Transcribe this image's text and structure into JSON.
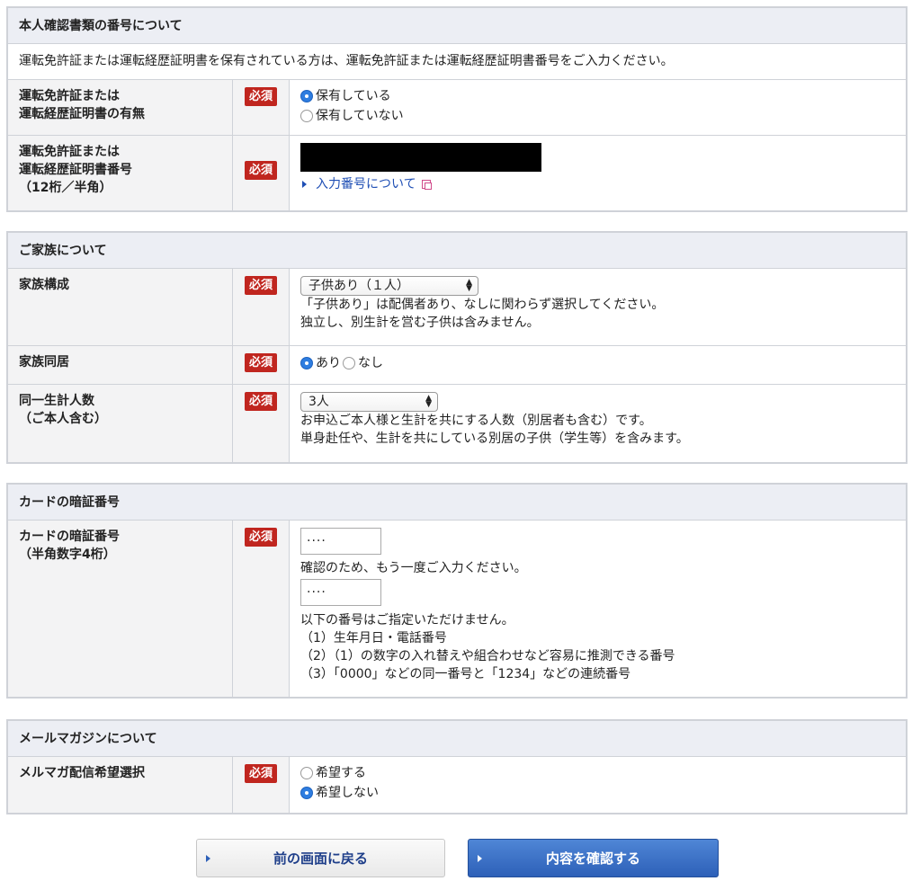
{
  "id_section": {
    "title": "本人確認書類の番号について",
    "intro": "運転免許証または運転経歴証明書を保有されている方は、運転免許証または運転経歴証明書番号をご入力ください。",
    "possession": {
      "label_1": "運転免許証または",
      "label_2": "運転経歴証明書の有無",
      "options": [
        "保有している",
        "保有していない"
      ],
      "selected": 0
    },
    "number": {
      "label_1": "運転免許証または",
      "label_2": "運転経歴証明書番号",
      "label_3": "（12桁／半角）",
      "link_text": "入力番号について"
    }
  },
  "family_section": {
    "title": "ご家族について",
    "composition": {
      "label": "家族構成",
      "selected_value": "子供あり（１人）",
      "note_1": "「子供あり」は配偶者あり、なしに関わらず選択してください。",
      "note_2": "独立し、別生計を営む子供は含みません。"
    },
    "cohabit": {
      "label": "家族同居",
      "options": [
        "あり",
        "なし"
      ],
      "selected": 0
    },
    "household": {
      "label_1": "同一生計人数",
      "label_2": "（ご本人含む）",
      "selected_value": "3人",
      "note_1": "お申込ご本人様と生計を共にする人数（別居者も含む）です。",
      "note_2": "単身赴任や、生計を共にしている別居の子供（学生等）を含みます。"
    }
  },
  "pin_section": {
    "title": "カードの暗証番号",
    "label_1": "カードの暗証番号",
    "label_2": "（半角数字4桁）",
    "pin_value": "····",
    "confirm_note": "確認のため、もう一度ご入力ください。",
    "confirm_value": "····",
    "rules_title": "以下の番号はご指定いただけません。",
    "rules": [
      "（1）生年月日・電話番号",
      "（2）（1）の数字の入れ替えや組合わせなど容易に推測できる番号",
      "（3）「0000」などの同一番号と「1234」などの連続番号"
    ]
  },
  "mail_section": {
    "title": "メールマガジンについて",
    "label": "メルマガ配信希望選択",
    "options": [
      "希望する",
      "希望しない"
    ],
    "selected": 1
  },
  "required_label": "必須",
  "buttons": {
    "back": "前の画面に戻る",
    "confirm": "内容を確認する"
  },
  "colors": {
    "required_bg": "#c0261f",
    "primary_button": "#2d60b8",
    "radio_selected": "#2e7de0"
  }
}
